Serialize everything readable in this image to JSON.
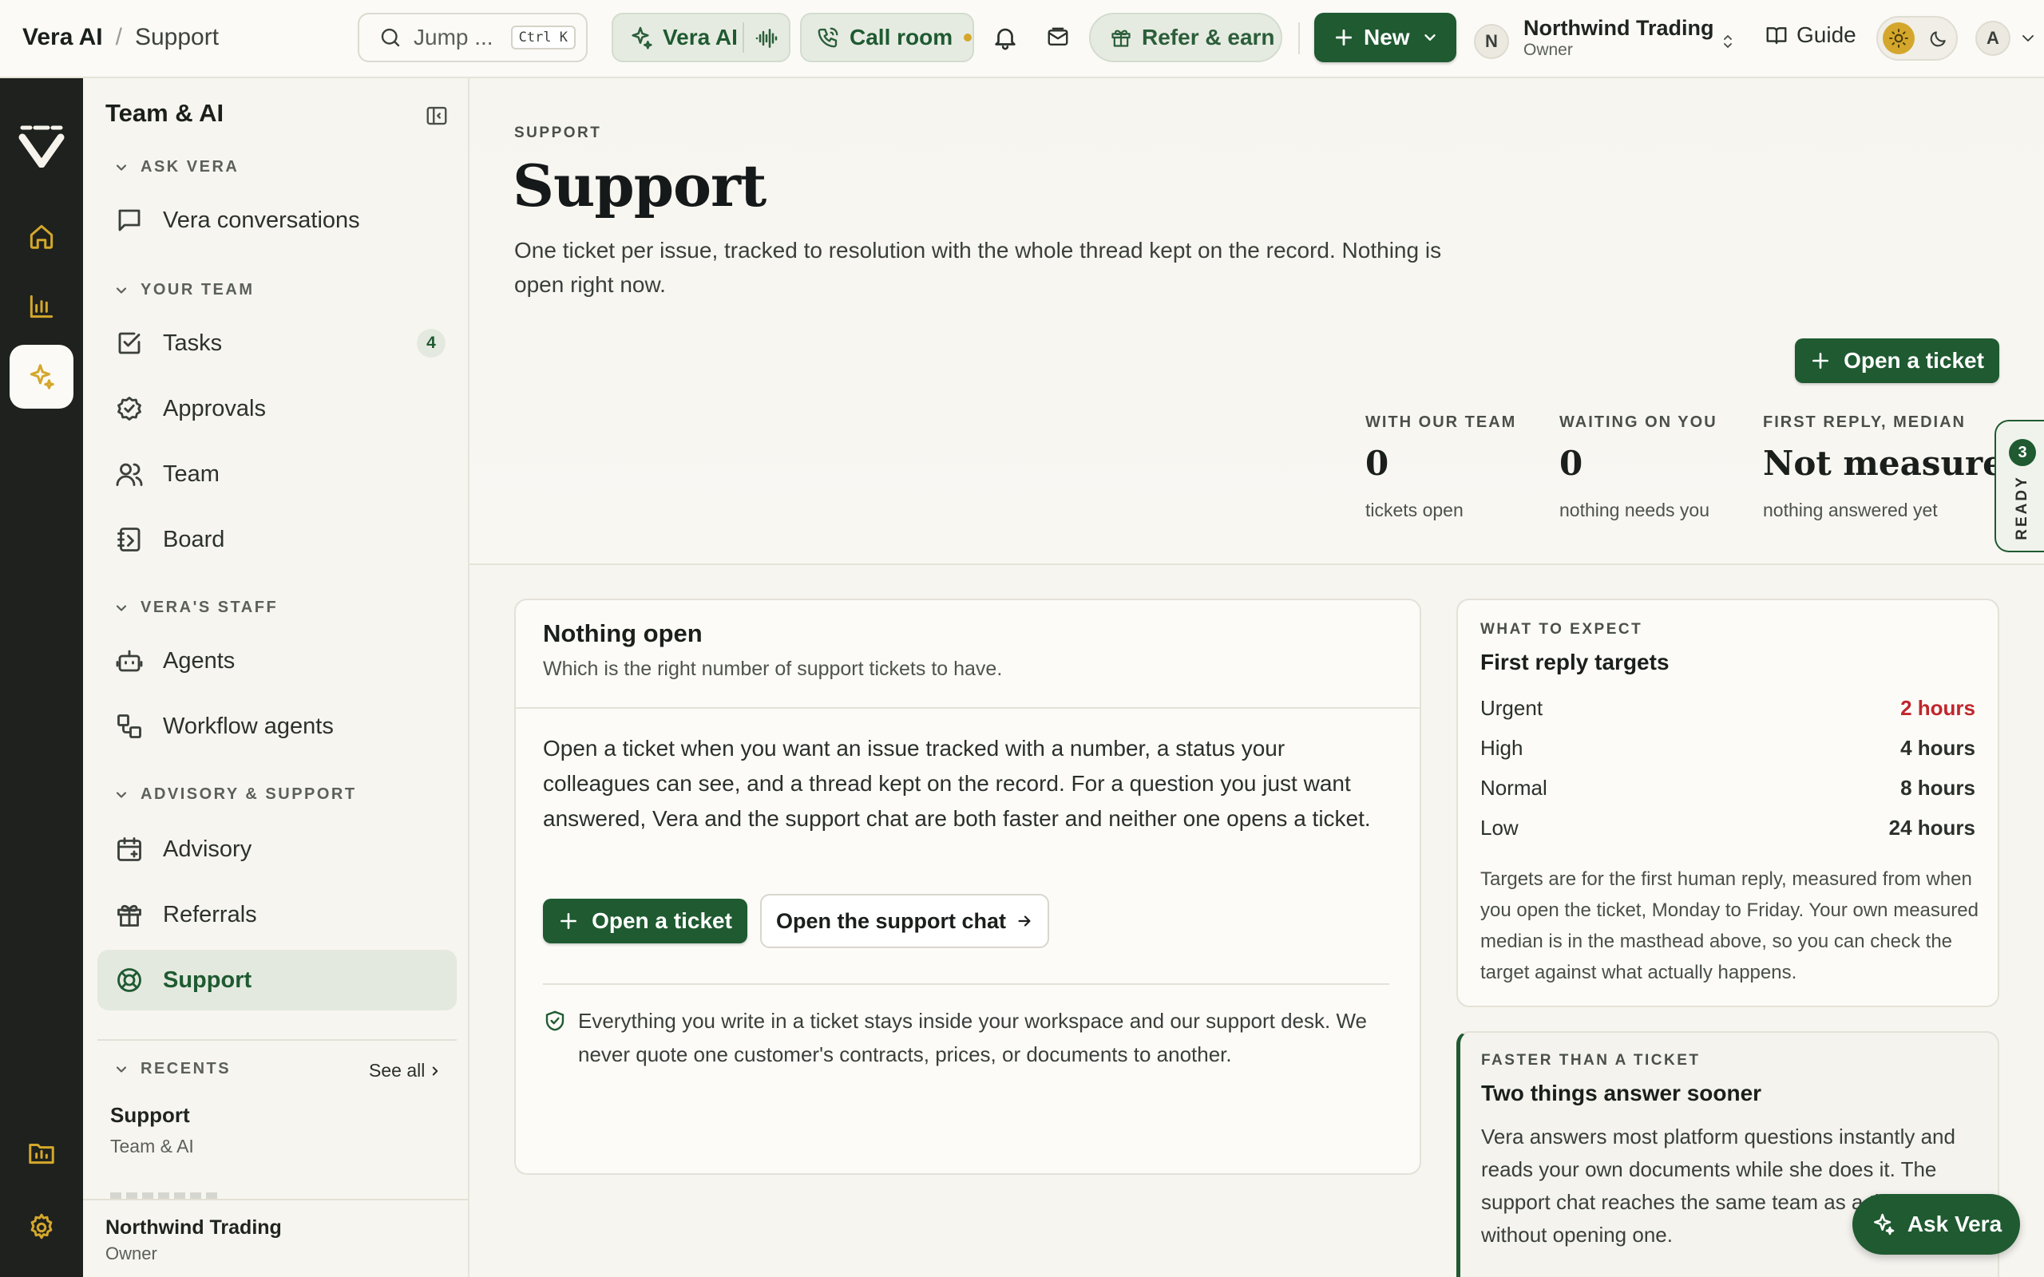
{
  "topbar": {
    "crumb_root": "Vera AI",
    "crumb_sep": "/",
    "crumb_current": "Support",
    "search_placeholder": "Jump ...",
    "search_shortcut": "Ctrl K",
    "vera_ai_label": "Vera AI",
    "call_room_label": "Call room",
    "refer_label": "Refer & earn",
    "new_label": "New",
    "org_initial": "N",
    "org_name": "Northwind Trading",
    "org_role": "Owner",
    "guide_label": "Guide",
    "user_initial": "A"
  },
  "sidebar": {
    "title": "Team & AI",
    "sections": {
      "ask_vera": "ASK VERA",
      "your_team": "YOUR TEAM",
      "veras_staff": "VERA'S STAFF",
      "advisory_support": "ADVISORY & SUPPORT",
      "recents": "RECENTS"
    },
    "items": {
      "vera_conversations": "Vera conversations",
      "tasks": "Tasks",
      "tasks_badge": "4",
      "approvals": "Approvals",
      "team": "Team",
      "board": "Board",
      "agents": "Agents",
      "workflow_agents": "Workflow agents",
      "advisory": "Advisory",
      "referrals": "Referrals",
      "support": "Support"
    },
    "recents_see_all": "See all",
    "recent_item_title": "Support",
    "recent_item_sub": "Team & AI",
    "footer_org": "Northwind Trading",
    "footer_role": "Owner"
  },
  "page": {
    "eyebrow": "SUPPORT",
    "title": "Support",
    "description": "One ticket per issue, tracked to resolution with the whole thread kept on the record. Nothing is open right now.",
    "open_ticket_label": "Open a ticket",
    "stats": [
      {
        "label": "WITH OUR TEAM",
        "value": "0",
        "sub": "tickets open"
      },
      {
        "label": "WAITING ON YOU",
        "value": "0",
        "sub": "nothing needs you"
      },
      {
        "label": "FIRST REPLY, MEDIAN",
        "value": "Not measured",
        "sub": "nothing answered yet"
      }
    ],
    "ready_tab": {
      "count": "3",
      "label": "READY"
    }
  },
  "empty_card": {
    "title": "Nothing open",
    "subtitle": "Which is the right number of support tickets to have.",
    "body": "Open a ticket when you want an issue tracked with a number, a status your colleagues can see, and a thread kept on the record. For a question you just want answered, Vera and the support chat are both faster and neither one opens a ticket.",
    "primary_label": "Open a ticket",
    "secondary_label": "Open the support chat",
    "privacy_note": "Everything you write in a ticket stays inside your workspace and our support desk. We never quote one customer's contracts, prices, or documents to another."
  },
  "expect_card": {
    "eyebrow": "WHAT TO EXPECT",
    "title": "First reply targets",
    "rows": [
      {
        "priority": "Urgent",
        "target": "2 hours",
        "color": "#c0262d"
      },
      {
        "priority": "High",
        "target": "4 hours",
        "color": "#1b1f1c"
      },
      {
        "priority": "Normal",
        "target": "8 hours",
        "color": "#1b1f1c"
      },
      {
        "priority": "Low",
        "target": "24 hours",
        "color": "#1b1f1c"
      }
    ],
    "note": "Targets are for the first human reply, measured from when you open the ticket, Monday to Friday. Your own measured median is in the masthead above, so you can check the target against what actually happens."
  },
  "faster_card": {
    "eyebrow": "FASTER THAN A TICKET",
    "title": "Two things answer sooner",
    "body": "Vera answers most platform questions instantly and reads your own documents while she does it. The support chat reaches the same team as a ticket without opening one."
  },
  "ask_vera_fab": "Ask Vera",
  "colors": {
    "accent": "#1f5a31",
    "accent_soft": "#e4e9e0",
    "rail": "#1e211d",
    "gold": "#d4a72c",
    "urgent": "#c0262d"
  }
}
